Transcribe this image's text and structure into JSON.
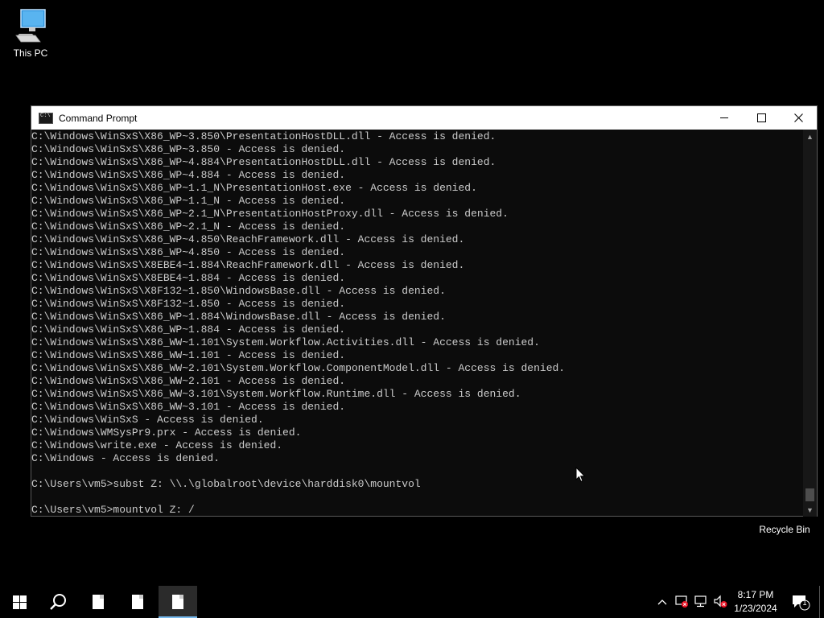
{
  "desktop": {
    "this_pc_label": "This PC",
    "recycle_bin_label": "Recycle Bin"
  },
  "window": {
    "title": "Command Prompt",
    "lines": [
      "C:\\Windows\\WinSxS\\X86_WP~3.850\\PresentationHostDLL.dll - Access is denied.",
      "C:\\Windows\\WinSxS\\X86_WP~3.850 - Access is denied.",
      "C:\\Windows\\WinSxS\\X86_WP~4.884\\PresentationHostDLL.dll - Access is denied.",
      "C:\\Windows\\WinSxS\\X86_WP~4.884 - Access is denied.",
      "C:\\Windows\\WinSxS\\X86_WP~1.1_N\\PresentationHost.exe - Access is denied.",
      "C:\\Windows\\WinSxS\\X86_WP~1.1_N - Access is denied.",
      "C:\\Windows\\WinSxS\\X86_WP~2.1_N\\PresentationHostProxy.dll - Access is denied.",
      "C:\\Windows\\WinSxS\\X86_WP~2.1_N - Access is denied.",
      "C:\\Windows\\WinSxS\\X86_WP~4.850\\ReachFramework.dll - Access is denied.",
      "C:\\Windows\\WinSxS\\X86_WP~4.850 - Access is denied.",
      "C:\\Windows\\WinSxS\\X8EBE4~1.884\\ReachFramework.dll - Access is denied.",
      "C:\\Windows\\WinSxS\\X8EBE4~1.884 - Access is denied.",
      "C:\\Windows\\WinSxS\\X8F132~1.850\\WindowsBase.dll - Access is denied.",
      "C:\\Windows\\WinSxS\\X8F132~1.850 - Access is denied.",
      "C:\\Windows\\WinSxS\\X86_WP~1.884\\WindowsBase.dll - Access is denied.",
      "C:\\Windows\\WinSxS\\X86_WP~1.884 - Access is denied.",
      "C:\\Windows\\WinSxS\\X86_WW~1.101\\System.Workflow.Activities.dll - Access is denied.",
      "C:\\Windows\\WinSxS\\X86_WW~1.101 - Access is denied.",
      "C:\\Windows\\WinSxS\\X86_WW~2.101\\System.Workflow.ComponentModel.dll - Access is denied.",
      "C:\\Windows\\WinSxS\\X86_WW~2.101 - Access is denied.",
      "C:\\Windows\\WinSxS\\X86_WW~3.101\\System.Workflow.Runtime.dll - Access is denied.",
      "C:\\Windows\\WinSxS\\X86_WW~3.101 - Access is denied.",
      "C:\\Windows\\WinSxS - Access is denied.",
      "C:\\Windows\\WMSysPr9.prx - Access is denied.",
      "C:\\Windows\\write.exe - Access is denied.",
      "C:\\Windows - Access is denied.",
      "",
      "C:\\Users\\vm5>subst Z: \\\\.\\globalroot\\device\\harddisk0\\mountvol",
      "",
      "C:\\Users\\vm5>mountvol Z: /"
    ]
  },
  "taskbar": {
    "time": "8:17 PM",
    "date": "1/23/2024",
    "notification_count": "1"
  },
  "icons": {
    "start": "windows-start-icon",
    "search": "search-icon",
    "chevron": "chevron-up-icon",
    "network": "network-icon",
    "volume": "volume-muted-icon"
  }
}
